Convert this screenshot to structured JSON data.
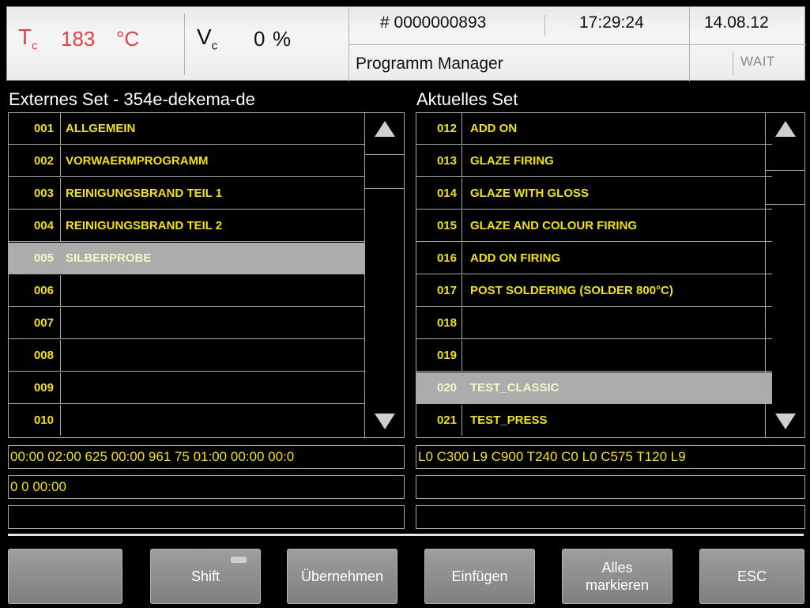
{
  "header": {
    "tc_symbol": "T",
    "tc_sub": "c",
    "tc_value": "183",
    "tc_unit": "°C",
    "vc_symbol": "V",
    "vc_sub": "c",
    "vc_value": "0",
    "vc_unit": "%",
    "program_number": "# 0000000893",
    "clock": "17:29:24",
    "date": "14.08.12",
    "module": "Programm Manager",
    "status": "WAIT"
  },
  "left_panel": {
    "heading": "Externes Set - 354e-dekema-de",
    "rows": [
      {
        "num": "001",
        "name": "ALLGEMEIN"
      },
      {
        "num": "002",
        "name": "VORWAERMPROGRAMM"
      },
      {
        "num": "003",
        "name": "REINIGUNGSBRAND TEIL 1"
      },
      {
        "num": "004",
        "name": "REINIGUNGSBRAND TEIL 2"
      },
      {
        "num": "005",
        "name": "SILBERPROBE"
      },
      {
        "num": "006",
        "name": ""
      },
      {
        "num": "007",
        "name": ""
      },
      {
        "num": "008",
        "name": ""
      },
      {
        "num": "009",
        "name": ""
      },
      {
        "num": "010",
        "name": ""
      }
    ],
    "selected_index": 4,
    "info_line1": "00:00 02:00 625 00:00 961 75 01:00 00:00 00:0",
    "info_line2": "0 0 00:00",
    "info_line3": ""
  },
  "right_panel": {
    "heading": "Aktuelles Set",
    "rows": [
      {
        "num": "012",
        "name": "ADD ON"
      },
      {
        "num": "013",
        "name": "GLAZE FIRING"
      },
      {
        "num": "014",
        "name": "GLAZE WITH GLOSS"
      },
      {
        "num": "015",
        "name": "GLAZE AND COLOUR FIRING"
      },
      {
        "num": "016",
        "name": "ADD ON FIRING"
      },
      {
        "num": "017",
        "name": "POST SOLDERING  (SOLDER 800°C)"
      },
      {
        "num": "018",
        "name": ""
      },
      {
        "num": "019",
        "name": ""
      },
      {
        "num": "020",
        "name": "TEST_CLASSIC"
      },
      {
        "num": "021",
        "name": "TEST_PRESS"
      }
    ],
    "selected_index": 8,
    "info_line1": "L0 C300 L9 C900 T240 C0 L0 C575 T120 L9",
    "info_line2": "",
    "info_line3": ""
  },
  "buttons": {
    "b1": "",
    "shift": "Shift",
    "uebernehmen": "Übernehmen",
    "einfuegen": "Einfügen",
    "alles_markieren_line1": "Alles",
    "alles_markieren_line2": "markieren",
    "esc": "ESC"
  },
  "icons": {
    "scroll_up": "triangle-up-icon",
    "scroll_down": "triangle-down-icon"
  },
  "colors": {
    "list_text": "#f2e400",
    "temperature": "#e34040",
    "selected_row": "#acacac"
  }
}
